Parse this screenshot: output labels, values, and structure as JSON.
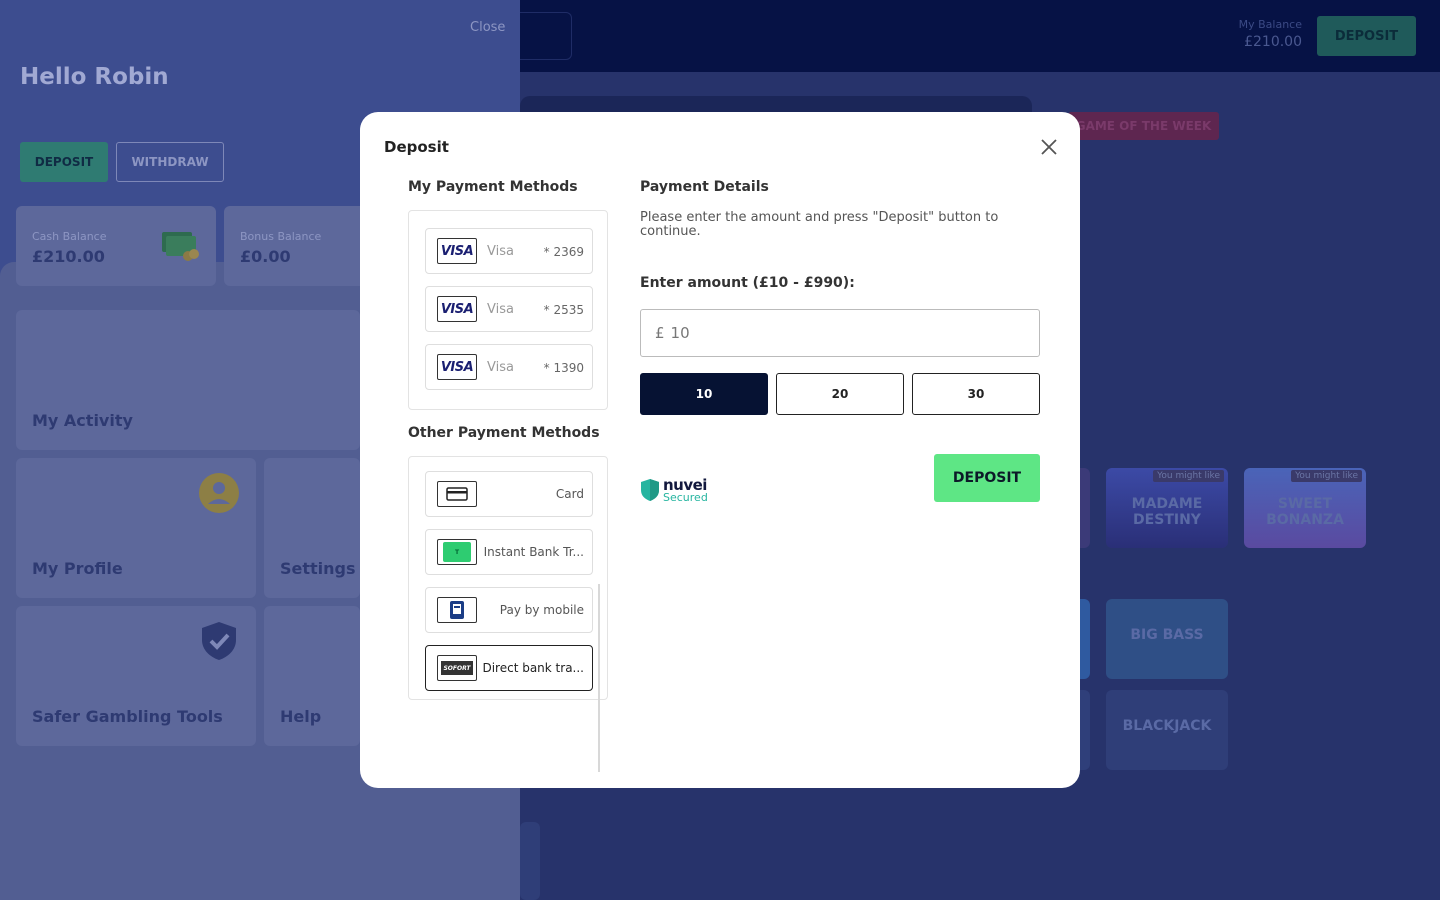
{
  "site": {
    "balance_label": "My Balance",
    "balance_value": "£210.00",
    "deposit_label": "DEPOSIT",
    "game_of_week": "GAME OF THE WEEK",
    "tiles": [
      {
        "label": "MADAME DESTINY",
        "badge": "You might like"
      },
      {
        "label": "SWEET BONANZA",
        "badge": "You might like"
      },
      {
        "label": "BIG BASS",
        "badge": ""
      },
      {
        "label": "BLACKJACK",
        "badge": ""
      }
    ]
  },
  "side_panel": {
    "close_label": "Close",
    "greeting": "Hello Robin",
    "deposit_label": "DEPOSIT",
    "withdraw_label": "WITHDRAW",
    "cash_balance_label": "Cash Balance",
    "cash_balance_value": "£210.00",
    "bonus_balance_label": "Bonus Balance",
    "bonus_balance_value": "£0.00",
    "menu": [
      "My Activity",
      "My Profile",
      "Settings",
      "Safer Gambling Tools",
      "Help"
    ]
  },
  "modal": {
    "title": "Deposit",
    "my_methods_title": "My Payment Methods",
    "saved_methods": [
      {
        "name": "Visa",
        "last4": "* 2369",
        "logo": "visa-logo"
      },
      {
        "name": "Visa",
        "last4": "* 2535",
        "logo": "visa-logo"
      },
      {
        "name": "Visa",
        "last4": "* 1390",
        "logo": "visa-logo"
      }
    ],
    "other_methods_title": "Other Payment Methods",
    "other_methods": [
      {
        "name": "Card",
        "icon": "card-icon"
      },
      {
        "name": "Instant Bank Tr...",
        "icon": "trustly-icon"
      },
      {
        "name": "Pay by mobile",
        "icon": "mobile-pay-icon"
      },
      {
        "name": "Direct bank tra...",
        "icon": "sofort-icon",
        "selected": true
      }
    ],
    "details_title": "Payment Details",
    "details_desc": "Please enter the amount and press \"Deposit\" button to continue.",
    "amount_label": "Enter amount (£10 - £990):",
    "currency": "£",
    "amount_value": "10",
    "quick_amounts": [
      "10",
      "20",
      "30"
    ],
    "secured_brand": "nuvei",
    "secured_text": "Secured",
    "deposit_button": "DEPOSIT",
    "colors": {
      "deposit": "#5ee685",
      "active_amount": "#061233"
    }
  }
}
